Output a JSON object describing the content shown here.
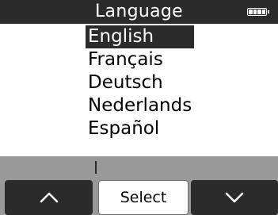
{
  "header": {
    "title": "Language",
    "battery_icon": "battery-full-icon"
  },
  "languages": [
    {
      "label": "English",
      "selected": true
    },
    {
      "label": "Français",
      "selected": false
    },
    {
      "label": "Deutsch",
      "selected": false
    },
    {
      "label": "Nederlands",
      "selected": false
    },
    {
      "label": "Español",
      "selected": false
    }
  ],
  "softkeys": {
    "left_icon": "chevron-up-icon",
    "center_label": "Select",
    "right_icon": "chevron-down-icon"
  },
  "colors": {
    "dark": "#2b2b2b",
    "panel": "#999999",
    "text": "#000000",
    "background": "#ffffff"
  }
}
